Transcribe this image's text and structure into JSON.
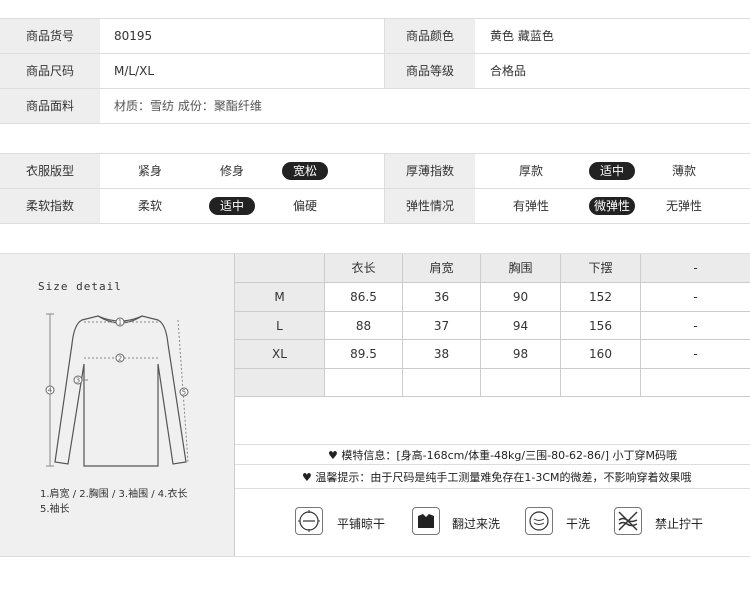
{
  "product_info": {
    "rows": [
      {
        "label1": "商品货号",
        "value1": "80195",
        "label2": "商品颜色",
        "value2": "黄色 藏蓝色"
      },
      {
        "label1": "商品尺码",
        "value1": "M/L/XL",
        "label2": "商品等级",
        "value2": "合格品"
      },
      {
        "label1": "商品面料",
        "value1": "材质：雪纺  成份：聚酯纤维"
      }
    ]
  },
  "fit": {
    "rows": [
      {
        "label1": "衣服版型",
        "opts1": [
          "紧身",
          "修身",
          "宽松"
        ],
        "sel1": 2,
        "label2": "厚薄指数",
        "opts2": [
          "厚款",
          "适中",
          "薄款"
        ],
        "sel2": 1
      },
      {
        "label1": "柔软指数",
        "opts1": [
          "柔软",
          "适中",
          "偏硬"
        ],
        "sel1": 1,
        "label2": "弹性情况",
        "opts2": [
          "有弹性",
          "微弹性",
          "无弹性"
        ],
        "sel2": 1
      }
    ]
  },
  "size_detail": {
    "title": "Size detail",
    "legend_line1": "1.肩宽 / 2.胸围 / 3.袖围 / 4.衣长",
    "legend_line2": "5.袖长",
    "markers": [
      "1",
      "2",
      "3",
      "4",
      "5"
    ]
  },
  "size_table": {
    "headers": [
      "衣长",
      "肩宽",
      "胸围",
      "下摆",
      "-"
    ],
    "rows": [
      {
        "size": "M",
        "values": [
          "86.5",
          "36",
          "90",
          "152",
          "-"
        ]
      },
      {
        "size": "L",
        "values": [
          "88",
          "37",
          "94",
          "156",
          "-"
        ]
      },
      {
        "size": "XL",
        "values": [
          "89.5",
          "38",
          "98",
          "160",
          "-"
        ]
      }
    ]
  },
  "notes": {
    "model_info": "模特信息：[身高-168cm/体重-48kg/三围-80-62-86/]  小丁穿M码哦",
    "reminder": "温馨提示：由于尺码是纯手工测量难免存在1-3CM的微差，不影响穿着效果哦"
  },
  "care": [
    {
      "icon": "flat-dry-icon",
      "label": "平铺晾干"
    },
    {
      "icon": "turn-inside-out-icon",
      "label": "翻过来洗"
    },
    {
      "icon": "dry-clean-icon",
      "label": "干洗"
    },
    {
      "icon": "do-not-wring-icon",
      "label": "禁止拧干"
    }
  ]
}
